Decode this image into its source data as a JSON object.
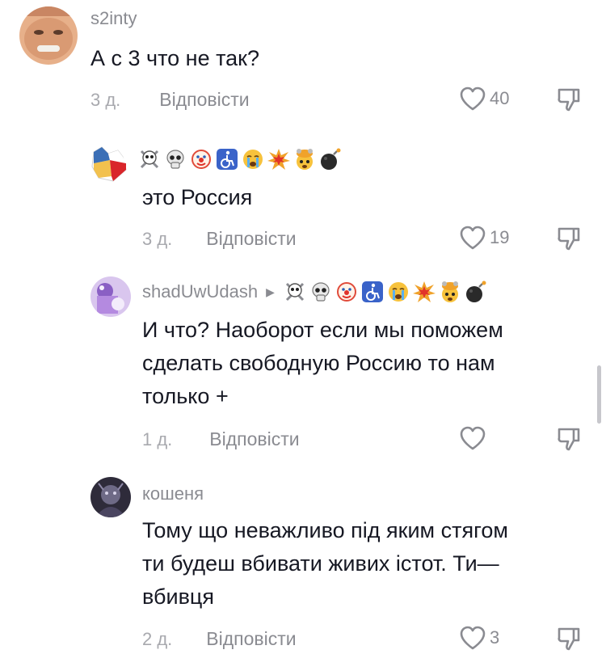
{
  "comments": [
    {
      "username": "s2inty",
      "text": "А с 3 что не так?",
      "date": "3 д.",
      "reply": "Відповісти",
      "likes": "40"
    },
    {
      "username": "",
      "text": "это Россия",
      "date": "3 д.",
      "reply": "Відповісти",
      "likes": "19",
      "emojis": [
        "skull-crossbones",
        "skull",
        "clown",
        "wheelchair",
        "crying",
        "collision",
        "exploding-head",
        "bomb"
      ]
    },
    {
      "username": "shadUwUdash",
      "text": "И что? Наоборот если мы поможем\nсделать свободную Россию то нам\nтолько +",
      "date": "1 д.",
      "reply": "Відповісти",
      "likes": "",
      "emojis": [
        "skull-crossbones",
        "skull",
        "clown",
        "wheelchair",
        "crying",
        "collision",
        "exploding-head",
        "bomb"
      ]
    },
    {
      "username": "кошеня",
      "text": "Тому що неважливо під яким стягом\nти будеш вбивати живих істот. Ти—\nвбивця",
      "date": "2 д.",
      "reply": "Відповісти",
      "likes": "3"
    }
  ],
  "colors": {
    "text": "#161823",
    "muted": "#8a8b91",
    "date": "#a8a9ae"
  }
}
